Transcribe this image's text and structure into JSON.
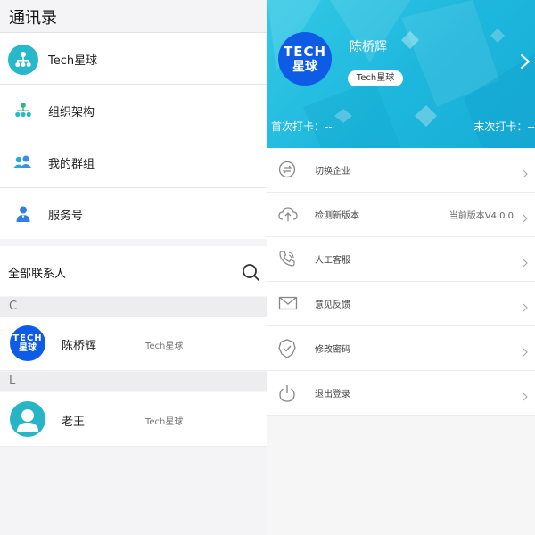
{
  "left": {
    "title": "通讯录",
    "menu": [
      {
        "label": "Tech星球",
        "icon": "org-tree-circle-icon"
      },
      {
        "label": "组织架构",
        "icon": "org-chart-icon"
      },
      {
        "label": "我的群组",
        "icon": "group-icon"
      },
      {
        "label": "服务号",
        "icon": "service-person-icon"
      }
    ],
    "contacts_title": "全部联系人",
    "sections": [
      {
        "letter": "C",
        "contacts": [
          {
            "name": "陈桥辉",
            "org": "Tech星球",
            "avatar": "tech-logo"
          }
        ]
      },
      {
        "letter": "L",
        "contacts": [
          {
            "name": "老王",
            "org": "Tech星球",
            "avatar": "default-person"
          }
        ]
      }
    ]
  },
  "right": {
    "profile": {
      "name": "陈桥辉",
      "company_badge": "Tech星球",
      "logo_text_top": "TECH",
      "logo_text_bottom": "星球",
      "first_checkin": "首次打卡：--",
      "last_checkin": "末次打卡：--"
    },
    "settings": [
      {
        "label": "切换企业",
        "value": "",
        "icon": "switch-icon"
      },
      {
        "label": "检测新版本",
        "value": "当前版本V4.0.0",
        "icon": "cloud-upload-icon"
      },
      {
        "label": "人工客服",
        "value": "",
        "icon": "phone-icon"
      },
      {
        "label": "意见反馈",
        "value": "",
        "icon": "mail-icon"
      },
      {
        "label": "修改密码",
        "value": "",
        "icon": "shield-check-icon"
      },
      {
        "label": "退出登录",
        "value": "",
        "icon": "power-icon"
      }
    ]
  },
  "colors": {
    "accent": "#1fb3d8",
    "logo_blue": "#0e5ce6",
    "teal_icon": "#27b8c9"
  }
}
